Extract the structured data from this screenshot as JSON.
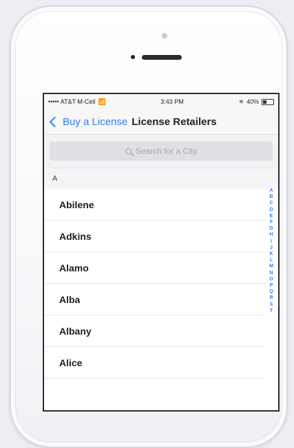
{
  "status_bar": {
    "carrier": "••••• AT&T M-Cell",
    "time": "3:43 PM",
    "battery": "40%"
  },
  "nav": {
    "back_label": "Buy a License",
    "title": "License Retailers"
  },
  "search": {
    "placeholder": "Search for a City"
  },
  "section_header": "A",
  "cities": [
    "Abilene",
    "Adkins",
    "Alamo",
    "Alba",
    "Albany",
    "Alice"
  ],
  "index_letters": [
    "A",
    "B",
    "C",
    "D",
    "E",
    "F",
    "G",
    "H",
    "I",
    "J",
    "K",
    "L",
    "M",
    "N",
    "O",
    "P",
    "Q",
    "R",
    "S",
    "T"
  ],
  "colors": {
    "accent": "#2f7cf6"
  }
}
